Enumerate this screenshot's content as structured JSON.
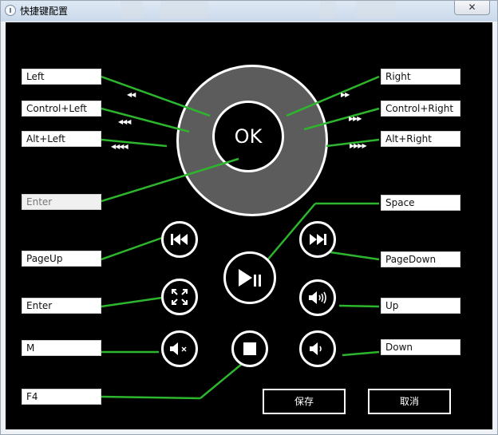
{
  "window": {
    "title": "快捷键配置",
    "close_glyph": "✕"
  },
  "colors": {
    "connector": "#2db52d",
    "dial": "#5c5c5c",
    "background": "#000000"
  },
  "dial": {
    "ok_label": "OK"
  },
  "fields": {
    "left": "Left",
    "control_left": "Control+Left",
    "alt_left": "Alt+Left",
    "enter_ok": "Enter",
    "page_up": "PageUp",
    "enter_fullscreen": "Enter",
    "mute": "M",
    "stop": "F4",
    "right": "Right",
    "control_right": "Control+Right",
    "alt_right": "Alt+Right",
    "space": "Space",
    "page_down": "PageDown",
    "volume_up": "Up",
    "volume_down": "Down"
  },
  "arrows": {
    "left1": "◀◀",
    "left2": "◀◀◀",
    "left3": "◀◀◀◀",
    "right1": "▶▶",
    "right2": "▶▶▶",
    "right3": "▶▶▶▶"
  },
  "icons": {
    "previous": "skip-previous-icon",
    "next": "skip-next-icon",
    "play_pause": "play-pause-icon",
    "fullscreen": "fullscreen-icon",
    "volume_up": "volume-up-icon",
    "mute": "mute-icon",
    "stop": "stop-icon",
    "volume_down": "volume-down-icon"
  },
  "buttons": {
    "save": "保存",
    "cancel": "取消"
  }
}
